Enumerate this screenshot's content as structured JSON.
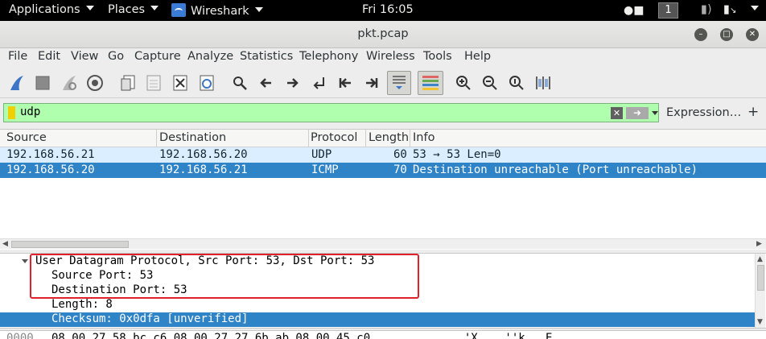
{
  "topbar": {
    "applications": "Applications",
    "places": "Places",
    "app": "Wireshark",
    "clock": "Fri 16:05",
    "workspace": "1"
  },
  "window": {
    "title": "pkt.pcap"
  },
  "menu": [
    "File",
    "Edit",
    "View",
    "Go",
    "Capture",
    "Analyze",
    "Statistics",
    "Telephony",
    "Wireless",
    "Tools",
    "Help"
  ],
  "toolbar_icons": [
    "start-capture-icon",
    "stop-capture-icon",
    "restart-capture-icon",
    "capture-options-icon",
    "open-file-icon",
    "save-file-icon",
    "close-file-icon",
    "reload-file-icon",
    "find-packet-icon",
    "go-back-icon",
    "go-forward-icon",
    "go-to-packet-icon",
    "first-packet-icon",
    "last-packet-icon",
    "auto-scroll-icon",
    "colorize-icon",
    "zoom-in-icon",
    "zoom-out-icon",
    "normal-size-icon",
    "resize-columns-icon"
  ],
  "filter": {
    "value": "udp",
    "expression_label": "Expression…",
    "add_label": "+"
  },
  "packet_list": {
    "columns": [
      "Source",
      "Destination",
      "Protocol",
      "Length",
      "Info"
    ],
    "rows": [
      {
        "source": "192.168.56.21",
        "destination": "192.168.56.20",
        "protocol": "UDP",
        "length": "60",
        "info": "53 → 53 Len=0"
      },
      {
        "source": "192.168.56.20",
        "destination": "192.168.56.21",
        "protocol": "ICMP",
        "length": "70",
        "info": "Destination unreachable (Port unreachable)"
      }
    ]
  },
  "details": {
    "header": "User Datagram Protocol, Src Port: 53, Dst Port: 53",
    "fields": [
      "Source Port: 53",
      "Destination Port: 53",
      "Length: 8",
      "Checksum: 0x0dfa [unverified]"
    ]
  },
  "bytes": {
    "offset": "0000",
    "hex": "08 00 27 58 bc c6 08 00  27 27 6b ab 08 00 45 c0",
    "ascii": "..'X....''k...E."
  },
  "colors": {
    "filter_valid": "#afffaf",
    "selected_row": "#2f84c7",
    "udp_row": "#daeeff",
    "highlight_box": "#e0202a"
  }
}
